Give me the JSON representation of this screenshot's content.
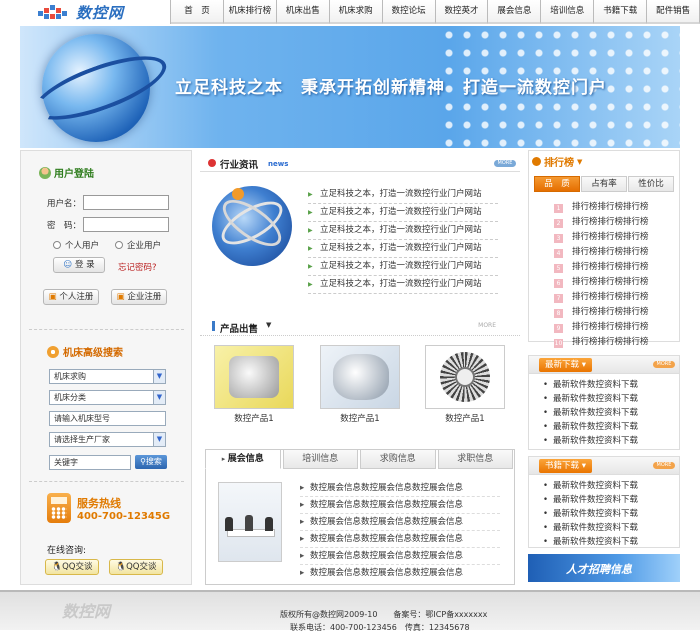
{
  "header": {
    "logo_text": "数控网",
    "nav": [
      "首　页",
      "机床排行榜",
      "机床出售",
      "机床求购",
      "数控论坛",
      "数控英才",
      "展会信息",
      "培训信息",
      "书籍下载",
      "配件销售"
    ]
  },
  "banner": {
    "slogan": "立足科技之本　秉承开拓创新精神　打造一流数控门户"
  },
  "login": {
    "title": "用户登陆",
    "username_label": "用户名：",
    "password_label": "密　码：",
    "radio_personal": "个人用户",
    "radio_company": "企业用户",
    "login_button": "登 录",
    "forgot_link": "忘记密码?",
    "personal_register": "个人注册",
    "company_register": "企业注册"
  },
  "search": {
    "title": "机床高级搜索",
    "select1": "机床求购",
    "select2": "机床分类",
    "model_input": "请输入机床型号",
    "select3": "请选择生产厂家",
    "keyword_input": "关键字",
    "search_button": "搜索"
  },
  "hotline": {
    "title": "服务热线",
    "number": "400-700-12345G"
  },
  "online": {
    "label": "在线咨询:",
    "qq1": "QQ交谈",
    "qq2": "QQ交谈"
  },
  "news": {
    "title": "行业资讯",
    "subtitle": "news",
    "more": "MORE",
    "items": [
      "立足科技之本，打造一流数控行业门户网站",
      "立足科技之本，打造一流数控行业门户网站",
      "立足科技之本，打造一流数控行业门户网站",
      "立足科技之本，打造一流数控行业门户网站",
      "立足科技之本，打造一流数控行业门户网站",
      "立足科技之本，打造一流数控行业门户网站"
    ]
  },
  "products": {
    "title": "产品出售",
    "more": "MORE",
    "items": [
      "数控产品1",
      "数控产品1",
      "数控产品1"
    ]
  },
  "tabs": [
    "展会信息",
    "培训信息",
    "求购信息",
    "求职信息"
  ],
  "exhibitions": [
    "数控展会信息数控展会信息数控展会信息",
    "数控展会信息数控展会信息数控展会信息",
    "数控展会信息数控展会信息数控展会信息",
    "数控展会信息数控展会信息数控展会信息",
    "数控展会信息数控展会信息数控展会信息",
    "数控展会信息数控展会信息数控展会信息"
  ],
  "ranking": {
    "title": "排行榜",
    "tabs": [
      "品　质",
      "占有率",
      "性价比"
    ],
    "items": [
      "排行榜排行榜排行榜",
      "排行榜排行榜排行榜",
      "排行榜排行榜排行榜",
      "排行榜排行榜排行榜",
      "排行榜排行榜排行榜",
      "排行榜排行榜排行榜",
      "排行榜排行榜排行榜",
      "排行榜排行榜排行榜",
      "排行榜排行榜排行榜",
      "排行榜排行榜排行榜"
    ],
    "numbers": [
      "1",
      "2",
      "3",
      "4",
      "5",
      "6",
      "7",
      "8",
      "9",
      "10"
    ]
  },
  "latest_downloads": {
    "title": "最新下载",
    "more": "MORE",
    "items": [
      "最新软件数控资料下载",
      "最新软件数控资料下载",
      "最新软件数控资料下载",
      "最新软件数控资料下载",
      "最新软件数控资料下载",
      "最新软件数控资料下载"
    ]
  },
  "book_downloads": {
    "title": "书籍下载",
    "more": "MORE",
    "items": [
      "最新软件数控资料下载",
      "最新软件数控资料下载",
      "最新软件数控资料下载",
      "最新软件数控资料下载",
      "最新软件数控资料下载",
      "最新软件数控资料下载"
    ]
  },
  "recruit_banner": "人才招聘信息",
  "footer": {
    "logo_text": "数控网",
    "copyright": "版权所有@数控网2009-10　　备案号：鄂ICP备xxxxxxx",
    "contact": "联系电话：400-700-123456　传真：12345678"
  }
}
